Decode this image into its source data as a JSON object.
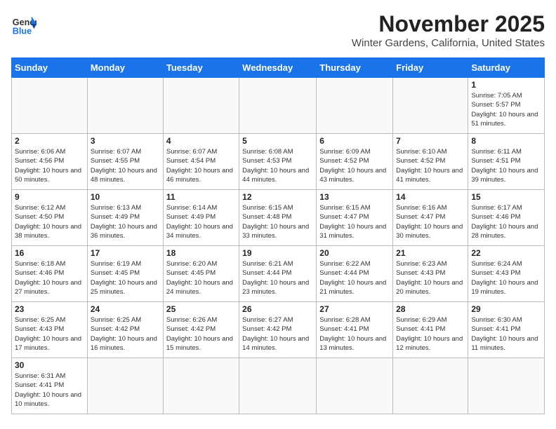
{
  "header": {
    "logo_general": "General",
    "logo_blue": "Blue",
    "month": "November 2025",
    "location": "Winter Gardens, California, United States"
  },
  "weekdays": [
    "Sunday",
    "Monday",
    "Tuesday",
    "Wednesday",
    "Thursday",
    "Friday",
    "Saturday"
  ],
  "weeks": [
    [
      {
        "day": "",
        "info": ""
      },
      {
        "day": "",
        "info": ""
      },
      {
        "day": "",
        "info": ""
      },
      {
        "day": "",
        "info": ""
      },
      {
        "day": "",
        "info": ""
      },
      {
        "day": "",
        "info": ""
      },
      {
        "day": "1",
        "info": "Sunrise: 7:05 AM\nSunset: 5:57 PM\nDaylight: 10 hours and 51 minutes."
      }
    ],
    [
      {
        "day": "2",
        "info": "Sunrise: 6:06 AM\nSunset: 4:56 PM\nDaylight: 10 hours and 50 minutes."
      },
      {
        "day": "3",
        "info": "Sunrise: 6:07 AM\nSunset: 4:55 PM\nDaylight: 10 hours and 48 minutes."
      },
      {
        "day": "4",
        "info": "Sunrise: 6:07 AM\nSunset: 4:54 PM\nDaylight: 10 hours and 46 minutes."
      },
      {
        "day": "5",
        "info": "Sunrise: 6:08 AM\nSunset: 4:53 PM\nDaylight: 10 hours and 44 minutes."
      },
      {
        "day": "6",
        "info": "Sunrise: 6:09 AM\nSunset: 4:52 PM\nDaylight: 10 hours and 43 minutes."
      },
      {
        "day": "7",
        "info": "Sunrise: 6:10 AM\nSunset: 4:52 PM\nDaylight: 10 hours and 41 minutes."
      },
      {
        "day": "8",
        "info": "Sunrise: 6:11 AM\nSunset: 4:51 PM\nDaylight: 10 hours and 39 minutes."
      }
    ],
    [
      {
        "day": "9",
        "info": "Sunrise: 6:12 AM\nSunset: 4:50 PM\nDaylight: 10 hours and 38 minutes."
      },
      {
        "day": "10",
        "info": "Sunrise: 6:13 AM\nSunset: 4:49 PM\nDaylight: 10 hours and 36 minutes."
      },
      {
        "day": "11",
        "info": "Sunrise: 6:14 AM\nSunset: 4:49 PM\nDaylight: 10 hours and 34 minutes."
      },
      {
        "day": "12",
        "info": "Sunrise: 6:15 AM\nSunset: 4:48 PM\nDaylight: 10 hours and 33 minutes."
      },
      {
        "day": "13",
        "info": "Sunrise: 6:15 AM\nSunset: 4:47 PM\nDaylight: 10 hours and 31 minutes."
      },
      {
        "day": "14",
        "info": "Sunrise: 6:16 AM\nSunset: 4:47 PM\nDaylight: 10 hours and 30 minutes."
      },
      {
        "day": "15",
        "info": "Sunrise: 6:17 AM\nSunset: 4:46 PM\nDaylight: 10 hours and 28 minutes."
      }
    ],
    [
      {
        "day": "16",
        "info": "Sunrise: 6:18 AM\nSunset: 4:46 PM\nDaylight: 10 hours and 27 minutes."
      },
      {
        "day": "17",
        "info": "Sunrise: 6:19 AM\nSunset: 4:45 PM\nDaylight: 10 hours and 25 minutes."
      },
      {
        "day": "18",
        "info": "Sunrise: 6:20 AM\nSunset: 4:45 PM\nDaylight: 10 hours and 24 minutes."
      },
      {
        "day": "19",
        "info": "Sunrise: 6:21 AM\nSunset: 4:44 PM\nDaylight: 10 hours and 23 minutes."
      },
      {
        "day": "20",
        "info": "Sunrise: 6:22 AM\nSunset: 4:44 PM\nDaylight: 10 hours and 21 minutes."
      },
      {
        "day": "21",
        "info": "Sunrise: 6:23 AM\nSunset: 4:43 PM\nDaylight: 10 hours and 20 minutes."
      },
      {
        "day": "22",
        "info": "Sunrise: 6:24 AM\nSunset: 4:43 PM\nDaylight: 10 hours and 19 minutes."
      }
    ],
    [
      {
        "day": "23",
        "info": "Sunrise: 6:25 AM\nSunset: 4:43 PM\nDaylight: 10 hours and 17 minutes."
      },
      {
        "day": "24",
        "info": "Sunrise: 6:25 AM\nSunset: 4:42 PM\nDaylight: 10 hours and 16 minutes."
      },
      {
        "day": "25",
        "info": "Sunrise: 6:26 AM\nSunset: 4:42 PM\nDaylight: 10 hours and 15 minutes."
      },
      {
        "day": "26",
        "info": "Sunrise: 6:27 AM\nSunset: 4:42 PM\nDaylight: 10 hours and 14 minutes."
      },
      {
        "day": "27",
        "info": "Sunrise: 6:28 AM\nSunset: 4:41 PM\nDaylight: 10 hours and 13 minutes."
      },
      {
        "day": "28",
        "info": "Sunrise: 6:29 AM\nSunset: 4:41 PM\nDaylight: 10 hours and 12 minutes."
      },
      {
        "day": "29",
        "info": "Sunrise: 6:30 AM\nSunset: 4:41 PM\nDaylight: 10 hours and 11 minutes."
      }
    ],
    [
      {
        "day": "30",
        "info": "Sunrise: 6:31 AM\nSunset: 4:41 PM\nDaylight: 10 hours and 10 minutes."
      },
      {
        "day": "",
        "info": ""
      },
      {
        "day": "",
        "info": ""
      },
      {
        "day": "",
        "info": ""
      },
      {
        "day": "",
        "info": ""
      },
      {
        "day": "",
        "info": ""
      },
      {
        "day": "",
        "info": ""
      }
    ]
  ]
}
